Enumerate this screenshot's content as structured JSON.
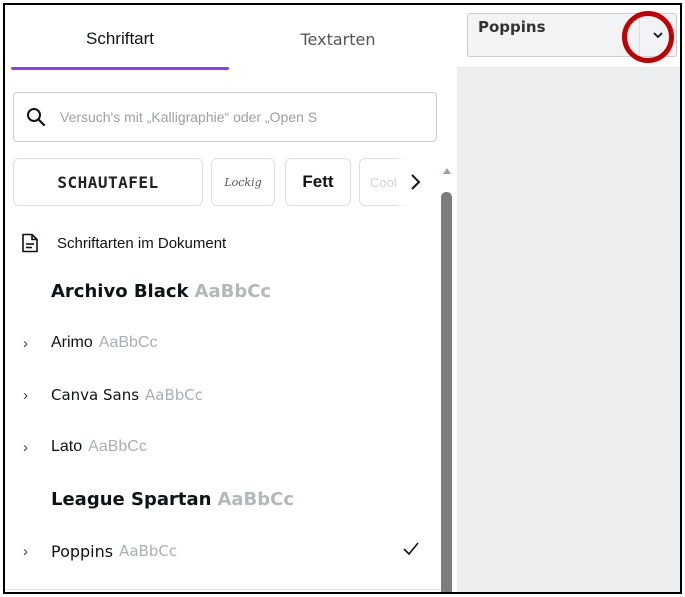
{
  "tabs": [
    {
      "label": "Schriftart",
      "active": true
    },
    {
      "label": "Textarten",
      "active": false
    }
  ],
  "search": {
    "placeholder": "Versuch's mit „Kalligraphie“ oder „Open S"
  },
  "style_chips": [
    {
      "label": "SCHAUTAFEL"
    },
    {
      "label": "Lockig"
    },
    {
      "label": "Fett"
    },
    {
      "label": "Cool"
    }
  ],
  "document_fonts_header": "Schriftarten im Dokument",
  "fonts": [
    {
      "name": "Archivo Black",
      "sample": "AaBbCc",
      "expandable": false,
      "selected": false
    },
    {
      "name": "Arimo",
      "sample": "AaBbCc",
      "expandable": true,
      "selected": false
    },
    {
      "name": "Canva Sans",
      "sample": "AaBbCc",
      "expandable": true,
      "selected": false
    },
    {
      "name": "Lato",
      "sample": "AaBbCc",
      "expandable": true,
      "selected": false
    },
    {
      "name": "League Spartan",
      "sample": "AaBbCc",
      "expandable": false,
      "selected": false
    },
    {
      "name": "Poppins",
      "sample": "AaBbCc",
      "expandable": true,
      "selected": true
    }
  ],
  "toolbar": {
    "font_value": "Poppins"
  },
  "colors": {
    "accent": "#8b3dff",
    "highlight": "#c00000",
    "canvas_bg": "#edeef0"
  }
}
